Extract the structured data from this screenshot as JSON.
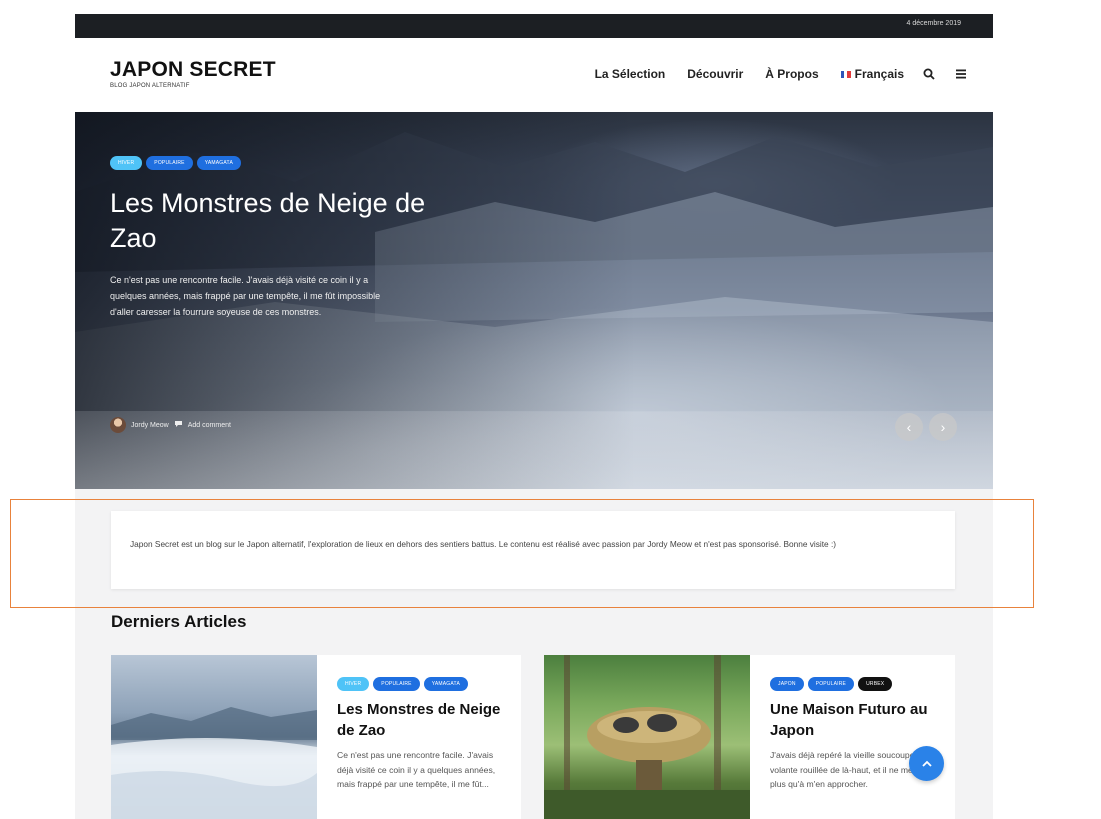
{
  "topbar": {
    "date": "4 décembre 2019"
  },
  "site": {
    "title": "JAPON SECRET",
    "tagline": "BLOG JAPON ALTERNATIF"
  },
  "nav": {
    "items": [
      "La Sélection",
      "Découvrir",
      "À Propos"
    ],
    "language": "Français",
    "search_icon": "search-icon",
    "menu_icon": "hamburger-menu-icon"
  },
  "hero": {
    "tags": [
      "HIVER",
      "POPULAIRE",
      "YAMAGATA"
    ],
    "title": "Les Monstres de Neige de Zao",
    "excerpt": "Ce n'est pas une rencontre facile. J'avais déjà visité ce coin il y a quelques années, mais frappé par une tempête, il me fût impossible d'aller caresser la fourrure soyeuse de ces monstres.",
    "author": "Jordy Meow",
    "comment": "Add comment",
    "prev_icon": "chevron-left-icon",
    "next_icon": "chevron-right-icon"
  },
  "intro": {
    "text": "Japon Secret est un blog sur le Japon alternatif, l'exploration de lieux en dehors des sentiers battus. Le contenu est réalisé avec passion par Jordy Meow et n'est pas sponsorisé. Bonne visite :)"
  },
  "latest": {
    "title": "Derniers Articles",
    "articles": [
      {
        "tags": [
          "HIVER",
          "POPULAIRE",
          "YAMAGATA"
        ],
        "title": "Les Monstres de Neige de Zao",
        "excerpt": "Ce n'est pas une rencontre facile. J'avais déjà visité ce coin il y a quelques années, mais frappé par une tempête, il me fût..."
      },
      {
        "tags": [
          "JAPON",
          "POPULAIRE",
          "URBEX"
        ],
        "title": "Une Maison Futuro au Japon",
        "excerpt": "J'avais déjà repéré la vieille soucoupe volante rouillée de là-haut, et il ne me restait plus qu'à m'en approcher."
      }
    ]
  },
  "scroll_top_icon": "chevron-up-icon",
  "colors": {
    "tag_light": "#4fc3f7",
    "tag_blue": "#1f6fe0",
    "tag_dark": "#111111",
    "accent": "#2a82e8",
    "highlight_border": "#e8823c"
  }
}
